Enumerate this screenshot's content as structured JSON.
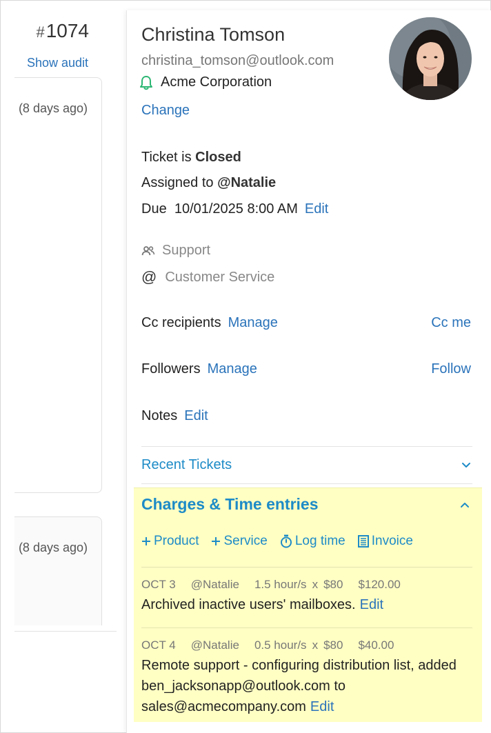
{
  "ticket": {
    "hash": "#",
    "number": "1074",
    "show_audit": "Show audit"
  },
  "messages": [
    {
      "time": "(8 days ago)"
    },
    {
      "time": "(8 days ago)"
    }
  ],
  "customer": {
    "name": "Christina Tomson",
    "email": "christina_tomson@outlook.com",
    "company": "Acme Corporation",
    "change_label": "Change"
  },
  "status": {
    "prefix": "Ticket is",
    "value": "Closed"
  },
  "assigned": {
    "prefix": "Assigned to",
    "value": "@Natalie"
  },
  "due": {
    "prefix": "Due",
    "value": "10/01/2025 8:00 AM",
    "edit_label": "Edit"
  },
  "group": "Support",
  "mailbox": {
    "at": "@",
    "name": "Customer Service"
  },
  "cc": {
    "label": "Cc recipients",
    "manage_label": "Manage",
    "action_label": "Cc me"
  },
  "followers": {
    "label": "Followers",
    "manage_label": "Manage",
    "action_label": "Follow"
  },
  "notes": {
    "label": "Notes",
    "edit_label": "Edit"
  },
  "recent_tickets": {
    "label": "Recent Tickets"
  },
  "charges": {
    "title": "Charges & Time entries",
    "actions": {
      "product": "Product",
      "service": "Service",
      "log_time": "Log time",
      "invoice": "Invoice"
    },
    "entries": [
      {
        "date": "OCT 3",
        "user": "@Natalie",
        "hours": "1.5 hour/s",
        "x": "x",
        "rate": "$80",
        "amount": "$120.00",
        "description": "Archived inactive users' mailboxes.",
        "edit_label": "Edit"
      },
      {
        "date": "OCT 4",
        "user": "@Natalie",
        "hours": "0.5 hour/s",
        "x": "x",
        "rate": "$80",
        "amount": "$40.00",
        "description": "Remote support - configuring distribution list, added ben_jacksonapp@outlook.com to sales@acmecompany.com",
        "edit_label": "Edit"
      }
    ]
  },
  "colors": {
    "link": "#2a73ba",
    "accent": "#1d8bc7",
    "charges_bg": "#ffffc4",
    "bell": "#2bb673"
  }
}
